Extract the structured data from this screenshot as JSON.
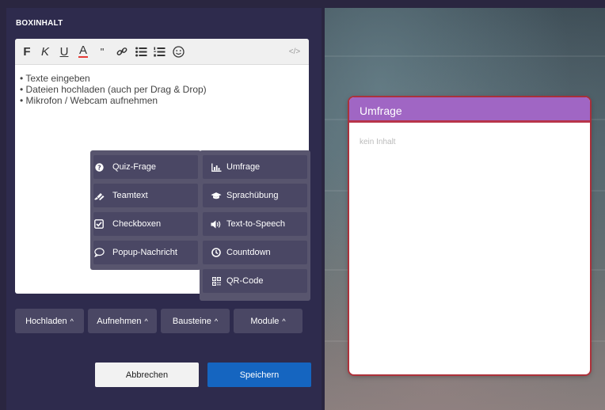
{
  "panel": {
    "title": "BOXINHALT"
  },
  "toolbar": {
    "bold": "F",
    "italic": "K",
    "underline": "U",
    "text_color": "A",
    "quote": "\"",
    "link_icon": "link-icon",
    "bullet_list_icon": "bullet-list-icon",
    "numbered_list_icon": "numbered-list-icon",
    "emoji_icon": "emoji-icon",
    "code_label": "</>"
  },
  "editor": {
    "lines": [
      "• Texte eingeben",
      "• Dateien hochladen (auch per Drag & Drop)",
      "• Mikrofon / Webcam aufnehmen"
    ]
  },
  "bausteine_menu": {
    "items": [
      {
        "label": "Quiz-Frage",
        "icon": "question-circle-icon",
        "glyph": "❓"
      },
      {
        "label": "Teamtext",
        "icon": "pencils-icon",
        "glyph": "✎"
      },
      {
        "label": "Checkboxen",
        "icon": "checkbox-icon",
        "glyph": "☑"
      },
      {
        "label": "Popup-Nachricht",
        "icon": "speech-bubble-icon",
        "glyph": "💬"
      }
    ]
  },
  "module_menu": {
    "items": [
      {
        "label": "Umfrage",
        "icon": "bar-chart-icon",
        "glyph": "📊"
      },
      {
        "label": "Sprachübung",
        "icon": "graduation-cap-icon",
        "glyph": "🎓"
      },
      {
        "label": "Text-to-Speech",
        "icon": "speaker-icon",
        "glyph": "🔊"
      },
      {
        "label": "Countdown",
        "icon": "clock-icon",
        "glyph": "⏱"
      },
      {
        "label": "QR-Code",
        "icon": "qr-code-icon",
        "glyph": "▦"
      }
    ]
  },
  "bottom_bar": {
    "hochladen": "Hochladen",
    "aufnehmen": "Aufnehmen",
    "bausteine": "Bausteine",
    "module": "Module",
    "caret": "^"
  },
  "actions": {
    "cancel": "Abbrechen",
    "save": "Speichern"
  },
  "preview": {
    "title": "Umfrage",
    "empty_text": "kein Inhalt"
  },
  "colors": {
    "panel_bg": "#2e2b4d",
    "button_bg": "#4a4764",
    "save_blue": "#1565c0",
    "card_header": "#a066c4",
    "card_border_red": "#b8344a"
  }
}
